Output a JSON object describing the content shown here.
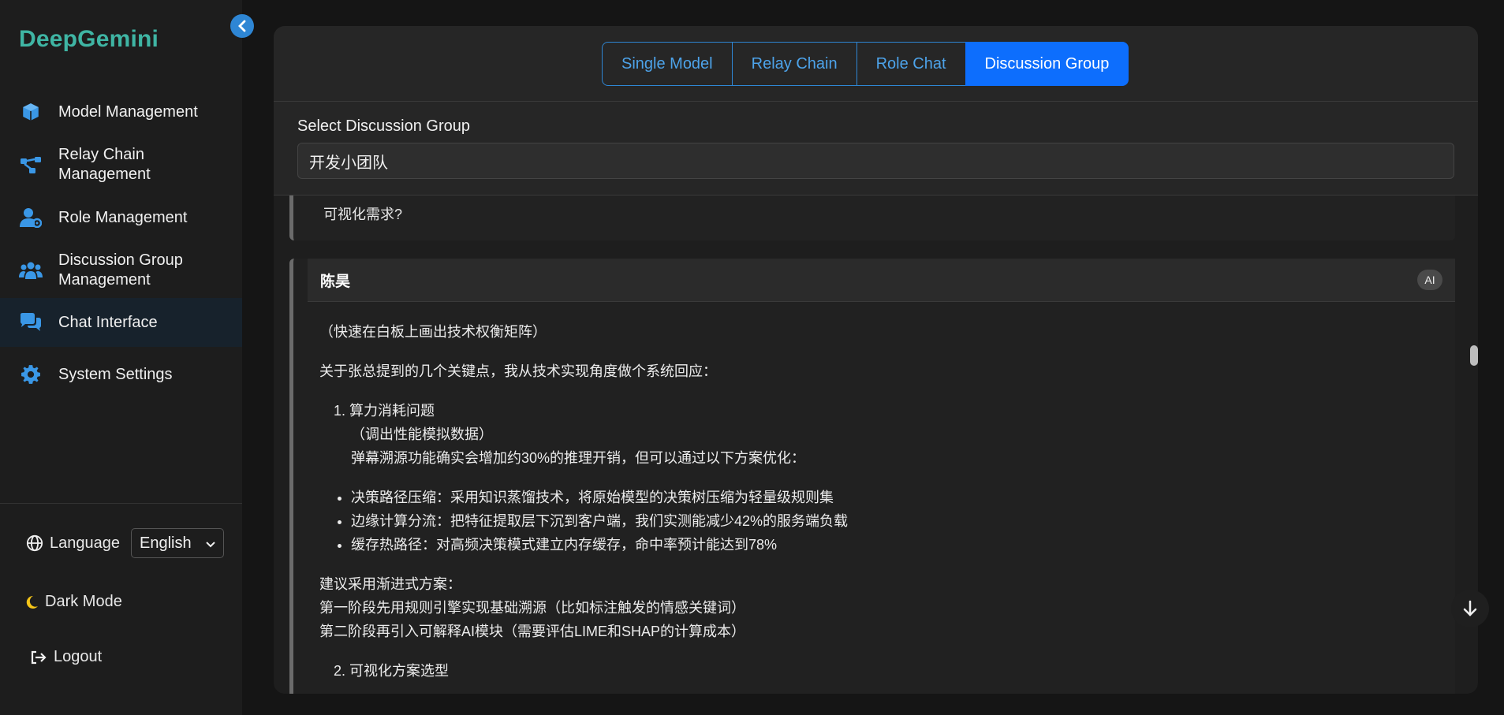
{
  "app": {
    "brand": "DeepGemini"
  },
  "sidebar": {
    "items": [
      {
        "label": "Model Management",
        "icon": "cube-icon"
      },
      {
        "label": "Relay Chain\nManagement",
        "icon": "chain-nodes-icon"
      },
      {
        "label": "Role Management",
        "icon": "user-cog-icon"
      },
      {
        "label": "Discussion Group\nManagement",
        "icon": "users-icon"
      },
      {
        "label": "Chat Interface",
        "icon": "chat-bubbles-icon",
        "active": true
      },
      {
        "label": "System Settings",
        "icon": "gear-icon"
      }
    ],
    "language_label": "Language",
    "language_value": "English",
    "dark_mode_label": "Dark Mode",
    "logout_label": "Logout"
  },
  "tabs": [
    {
      "label": "Single Model"
    },
    {
      "label": "Relay Chain"
    },
    {
      "label": "Role Chat"
    },
    {
      "label": "Discussion Group",
      "active": true
    }
  ],
  "group_select": {
    "label": "Select Discussion Group",
    "value": "开发小团队"
  },
  "chat": {
    "prev_message_tail": "可视化需求?",
    "message": {
      "author": "陈昊",
      "badge": "AI",
      "lines": {
        "l1": "（快速在白板上画出技术权衡矩阵）",
        "l2": "关于张总提到的几个关键点，我从技术实现角度做个系统回应：",
        "item1_title": "1. 算力消耗问题",
        "item1_note": "（调出性能模拟数据）",
        "item1_text": "弹幕溯源功能确实会增加约30%的推理开销，但可以通过以下方案优化：",
        "b1": "决策路径压缩：采用知识蒸馏技术，将原始模型的决策树压缩为轻量级规则集",
        "b2": "边缘计算分流：把特征提取层下沉到客户端，我们实测能减少42%的服务端负载",
        "b3": "缓存热路径：对高频决策模式建立内存缓存，命中率预计能达到78%",
        "p1": "建议采用渐进式方案：",
        "p2": "第一阶段先用规则引擎实现基础溯源（比如标注触发的情感关键词）",
        "p3": "第二阶段再引入可解释AI模块（需要评估LIME和SHAP的计算成本）",
        "item2_title": "2. 可视化方案选型"
      }
    }
  },
  "colors": {
    "brand": "#3fb5a4",
    "accent": "#0d6efd",
    "tab_border": "#2e86d4"
  }
}
